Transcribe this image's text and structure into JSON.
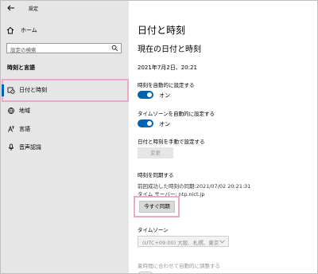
{
  "app": {
    "title": "設定"
  },
  "sidebar": {
    "home_label": "ホーム",
    "search_placeholder": "設定の検索",
    "section_title": "時刻と言語",
    "items": [
      {
        "label": "日付と時刻",
        "icon": "clock-calendar-icon",
        "active": true
      },
      {
        "label": "地域",
        "icon": "globe-icon",
        "active": false
      },
      {
        "label": "言語",
        "icon": "language-icon",
        "active": false
      },
      {
        "label": "音声認識",
        "icon": "microphone-icon",
        "active": false
      }
    ]
  },
  "main": {
    "page_title": "日付と時刻",
    "current_title": "現在の日付と時刻",
    "current_datetime": "2021年7月2日、20:21",
    "auto_time": {
      "label": "時刻を自動的に設定する",
      "state": "オン"
    },
    "auto_timezone": {
      "label": "タイムゾーンを自動的に設定する",
      "state": "オン"
    },
    "manual": {
      "label": "日付と時刻を手動で設定する",
      "button": "変更"
    },
    "sync": {
      "title": "時刻を同期する",
      "last_sync": "前回成功した時刻の同期:2021/07/02 20:21:31",
      "server": "タイム サーバー: ntp.nict.jp",
      "button": "今すぐ同期"
    },
    "timezone": {
      "label": "タイムゾーン",
      "value": "(UTC+09:00) 大阪、札幌、東京"
    },
    "dst_label": "夏時間に合わせて自動的に調整する"
  },
  "colors": {
    "accent": "#0063b1",
    "highlight": "#f2a7c9",
    "sidebar_bg": "#e6e6e6"
  }
}
